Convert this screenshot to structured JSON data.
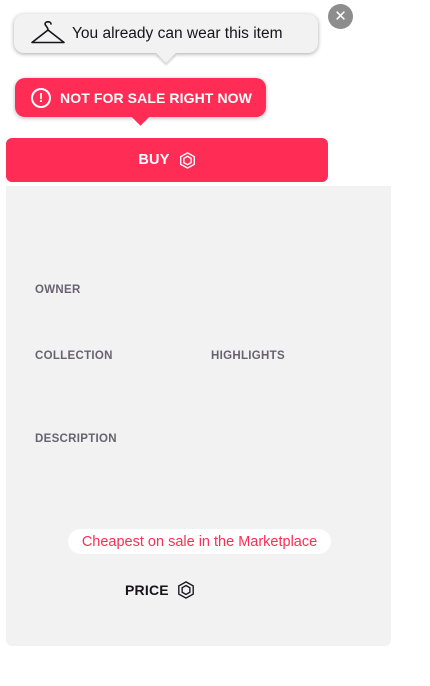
{
  "wearable_tooltip": {
    "text": "You already can wear this item",
    "icon": "hanger-icon"
  },
  "close_button": {
    "glyph": "✕",
    "icon": "close-icon"
  },
  "sale_tooltip": {
    "text": "NOT FOR SALE RIGHT NOW",
    "icon_glyph": "!",
    "icon": "alert-circle-icon",
    "color": "#ff2d55"
  },
  "buy_button": {
    "label": "BUY",
    "icon": "mana-hexagon-icon",
    "color": "#ff2d55"
  },
  "details": {
    "owner_label": "OWNER",
    "collection_label": "COLLECTION",
    "highlights_label": "HIGHLIGHTS",
    "description_label": "DESCRIPTION",
    "cheapest_badge": "Cheapest on sale in the Marketplace",
    "price_label": "PRICE",
    "price_icon": "mana-hexagon-icon"
  },
  "colors": {
    "accent": "#ff2d55",
    "panel_bg": "#f2f2f2",
    "label_gray": "#676370",
    "text_dark": "#16141a"
  }
}
